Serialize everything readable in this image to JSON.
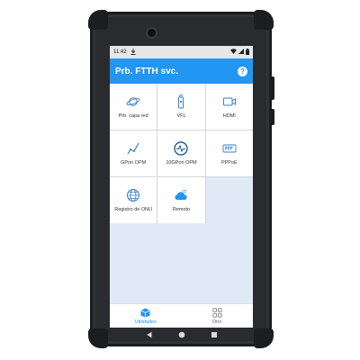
{
  "status_bar": {
    "time": "11:42"
  },
  "app_bar": {
    "title": "Prb. FTTH svc."
  },
  "tiles": [
    {
      "label": "Prb. capa red",
      "icon": "planet-icon"
    },
    {
      "label": "VFL",
      "icon": "laser-pen-icon"
    },
    {
      "label": "HDMI",
      "icon": "video-camera-icon"
    },
    {
      "label": "GPon OPM",
      "icon": "signal-graph-icon"
    },
    {
      "label": "10GPon OPM",
      "icon": "pulse-gauge-icon"
    },
    {
      "label": "PPPoE",
      "icon": "pppoe-badge-icon"
    },
    {
      "label": "Registro de ONU",
      "icon": "globe-grid-icon"
    },
    {
      "label": "Remoto",
      "icon": "cloud-wifi-icon"
    }
  ],
  "bottom_nav": {
    "items": [
      {
        "label": "Utilidades",
        "active": true
      },
      {
        "label": "Otro",
        "active": false
      }
    ]
  },
  "colors": {
    "accent": "#2196f3",
    "grid_background": "#dfeaf6",
    "device_body": "#2a2b2e"
  }
}
